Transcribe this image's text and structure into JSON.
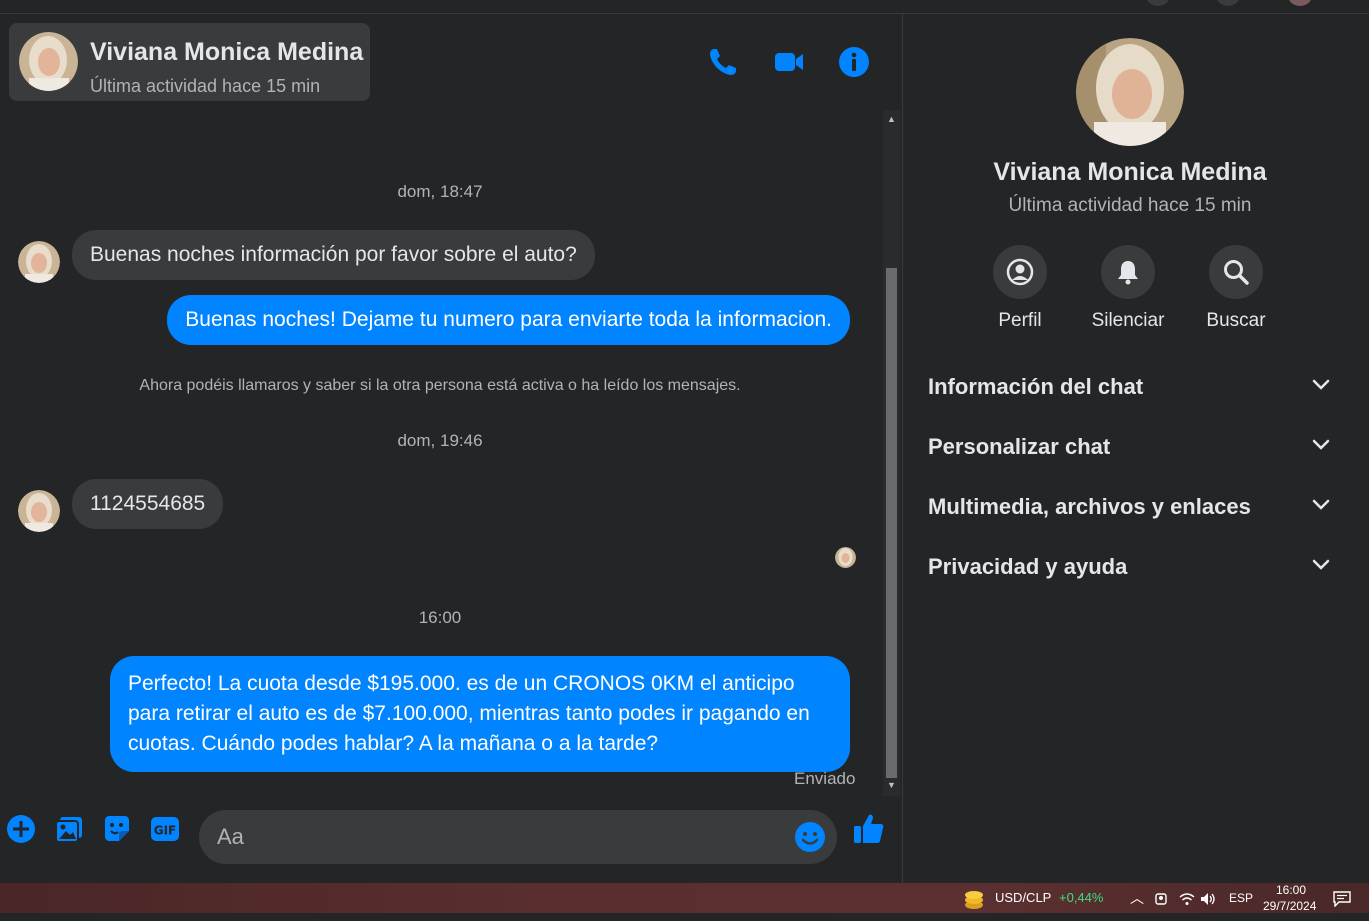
{
  "contact": {
    "name": "Viviana Monica Medina",
    "status": "Última actividad hace 15 min"
  },
  "header_icons": [
    "phone-icon",
    "video-icon",
    "info-icon"
  ],
  "messages": {
    "ts1": "dom, 18:47",
    "in1": "Buenas noches información por favor sobre el auto?",
    "out1": "Buenas noches! Dejame tu numero para enviarte toda la informacion.",
    "system": "Ahora podéis llamaros y saber si la otra persona está activa o ha leído los mensajes.",
    "ts2": "dom, 19:46",
    "in2": "1124554685",
    "ts3": "16:00",
    "out2": "Perfecto! La cuota desde $195.000. es de un CRONOS 0KM el anticipo para retirar el auto es de $7.100.000, mientras tanto podes ir pagando en cuotas. Cuándo podes hablar? A la mañana o a la tarde?",
    "sent_label": "Enviado"
  },
  "composer": {
    "placeholder": "Aa"
  },
  "side": {
    "actions": {
      "profile": "Perfil",
      "mute": "Silenciar",
      "search": "Buscar"
    },
    "sections": {
      "chat_info": "Información del chat",
      "customize": "Personalizar chat",
      "media": "Multimedia, archivos y enlaces",
      "privacy": "Privacidad y ayuda"
    }
  },
  "taskbar": {
    "ticker": "USD/CLP",
    "change": "+0,44%",
    "lang": "ESP",
    "time": "16:00",
    "date": "29/7/2024"
  },
  "colors": {
    "accent": "#0084ff",
    "background": "#242526",
    "bubble_in": "#3a3b3c",
    "positive": "#3ddc84"
  }
}
